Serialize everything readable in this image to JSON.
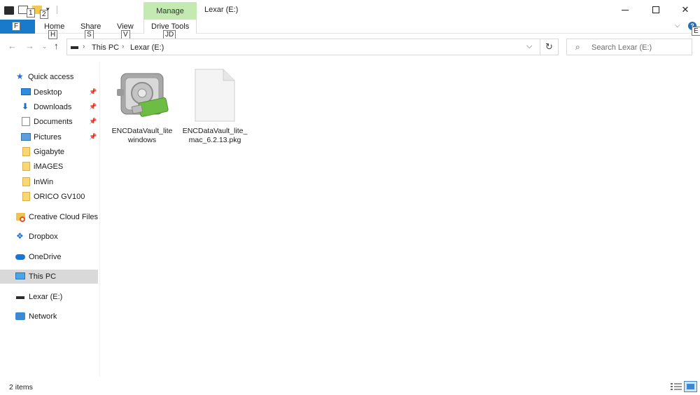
{
  "window": {
    "title": "Lexar (E:)",
    "context_tab": "Manage"
  },
  "quick_access_toolbar": {
    "keytips": [
      "1",
      "2"
    ]
  },
  "ribbon": {
    "file_keytip": "F",
    "tabs": [
      {
        "label": "Home",
        "keytip": "H"
      },
      {
        "label": "Share",
        "keytip": "S"
      },
      {
        "label": "View",
        "keytip": "V"
      },
      {
        "label": "Drive Tools",
        "keytip": "JD"
      }
    ],
    "help_keytip": "E"
  },
  "address_bar": {
    "breadcrumbs": [
      "This PC",
      "Lexar (E:)"
    ],
    "search_placeholder": "Search Lexar (E:)"
  },
  "nav_pane": {
    "quick_access": "Quick access",
    "pinned": [
      {
        "label": "Desktop",
        "icon": "desktop-icon"
      },
      {
        "label": "Downloads",
        "icon": "download-icon"
      },
      {
        "label": "Documents",
        "icon": "documents-icon"
      },
      {
        "label": "Pictures",
        "icon": "pictures-icon"
      }
    ],
    "folders": [
      "Gigabyte",
      "iMAGES",
      "InWin",
      "ORICO GV100"
    ],
    "creative_cloud": "Creative Cloud Files",
    "dropbox": "Dropbox",
    "onedrive": "OneDrive",
    "this_pc": "This PC",
    "lexar": "Lexar (E:)",
    "network": "Network"
  },
  "files": [
    {
      "name": "ENCDataVault_lite windows",
      "icon": "encdatavault-app-icon"
    },
    {
      "name": "ENCDataVault_lite_mac_6.2.13.pkg",
      "icon": "generic-file-icon"
    }
  ],
  "status_bar": {
    "item_count": "2 items"
  },
  "colors": {
    "file_tab": "#1979ca",
    "manage_tab": "#c3ebb1",
    "selected_nav": "#d9d9d9"
  }
}
